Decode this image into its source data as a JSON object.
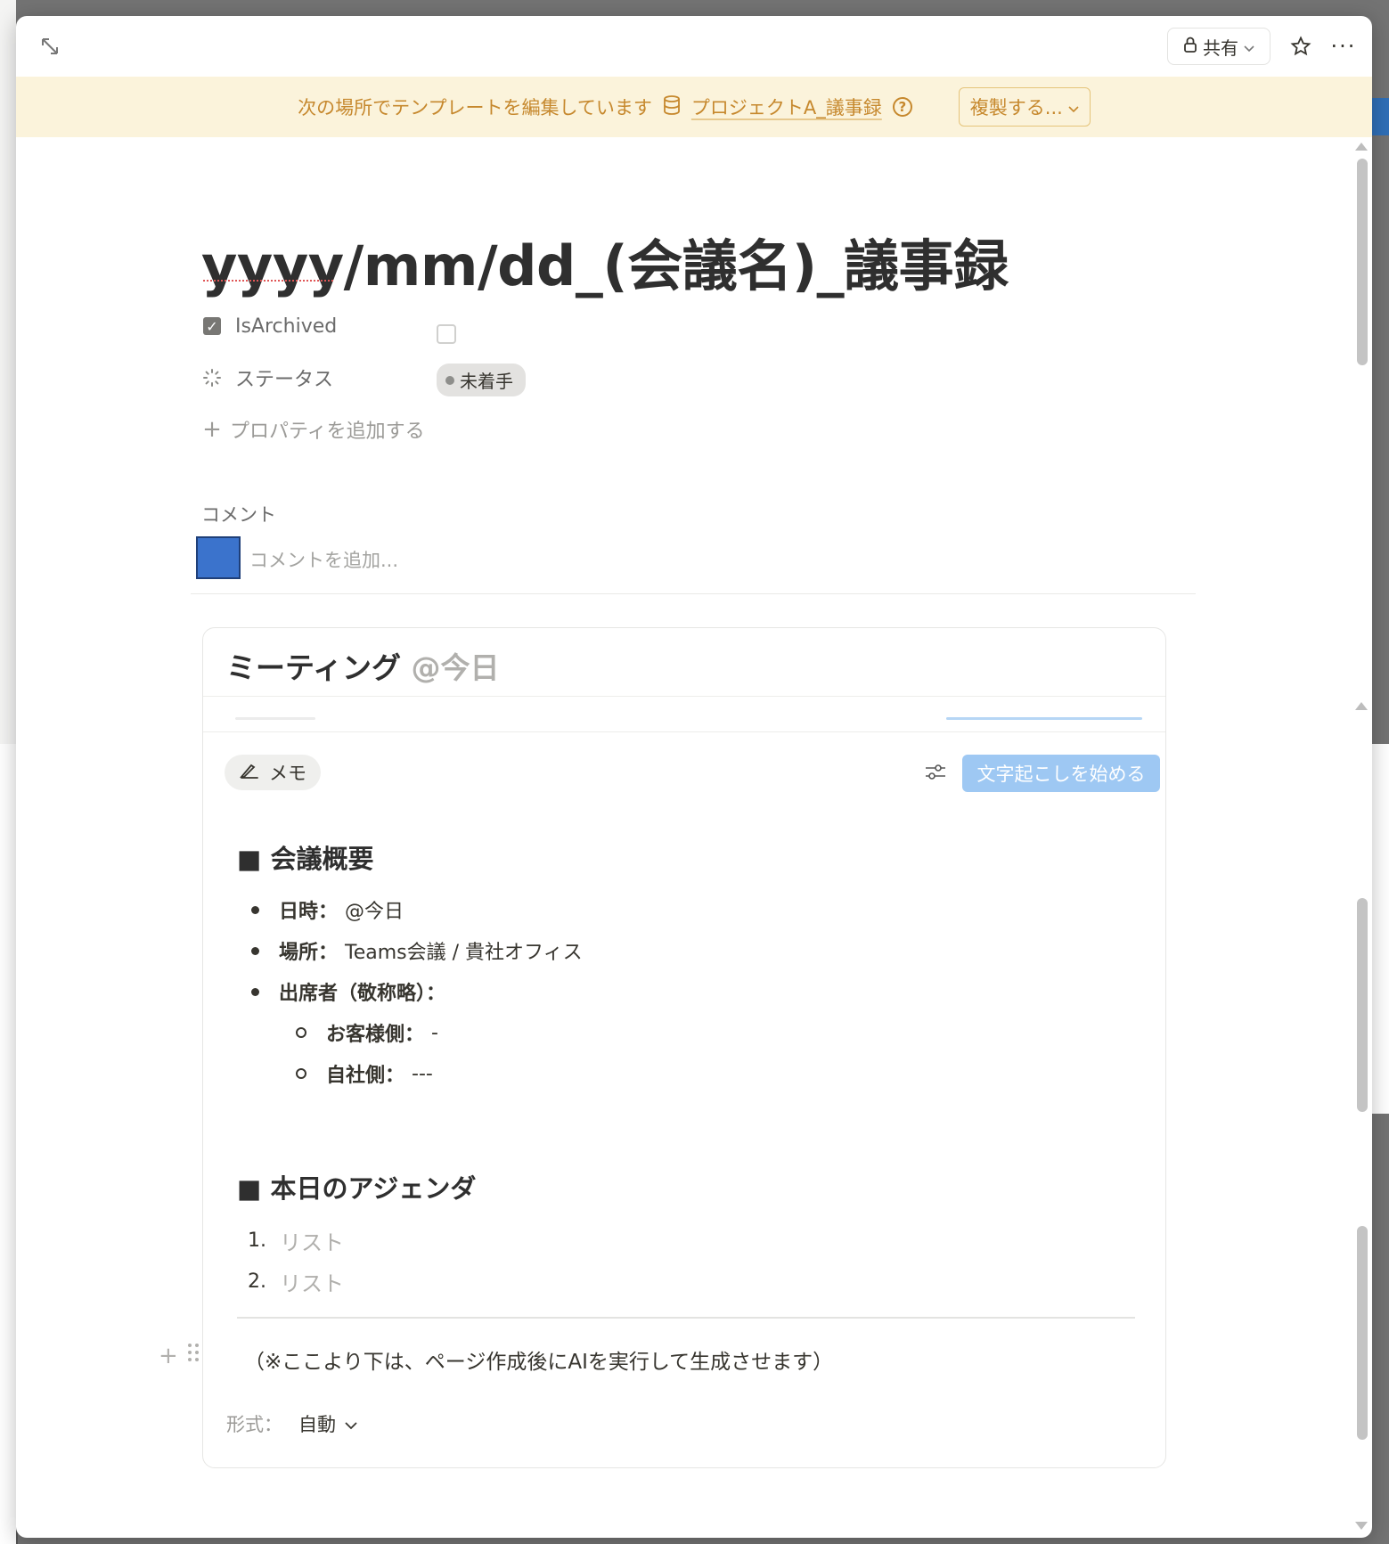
{
  "topbar": {
    "share_label": "共有",
    "more_label": "···"
  },
  "banner": {
    "text": "次の場所でテンプレートを編集しています",
    "db_name": "プロジェクトA_議事録",
    "duplicate_label": "複製する..."
  },
  "page": {
    "title": "yyyy/mm/dd_(会議名)_議事録"
  },
  "properties": {
    "archived": {
      "label": "IsArchived",
      "checked": false
    },
    "status": {
      "label": "ステータス",
      "value": "未着手"
    },
    "add_property": "プロパティを追加する"
  },
  "comments": {
    "label": "コメント",
    "placeholder": "コメントを追加..."
  },
  "meeting": {
    "title": "ミーティング",
    "date": "@今日",
    "memo_tab": "メモ",
    "transcribe_label": "文字起こしを始める",
    "section1": "■ 会議概要",
    "items": [
      {
        "label": "日時：",
        "value": "@今日"
      },
      {
        "label": "場所：",
        "value": "Teams会議 / 貴社オフィス"
      },
      {
        "label": "出席者（敬称略）：",
        "value": ""
      }
    ],
    "subitems": [
      {
        "label": "お客様側：",
        "value": "-"
      },
      {
        "label": "自社側：",
        "value": "---"
      }
    ],
    "section2": "■ 本日のアジェンダ",
    "agenda": [
      {
        "num": "1.",
        "placeholder": "リスト"
      },
      {
        "num": "2.",
        "placeholder": "リスト"
      }
    ],
    "note": "（※ここより下は、ページ作成後にAIを実行して生成させます）",
    "format_label": "形式：",
    "format_value": "自動"
  }
}
